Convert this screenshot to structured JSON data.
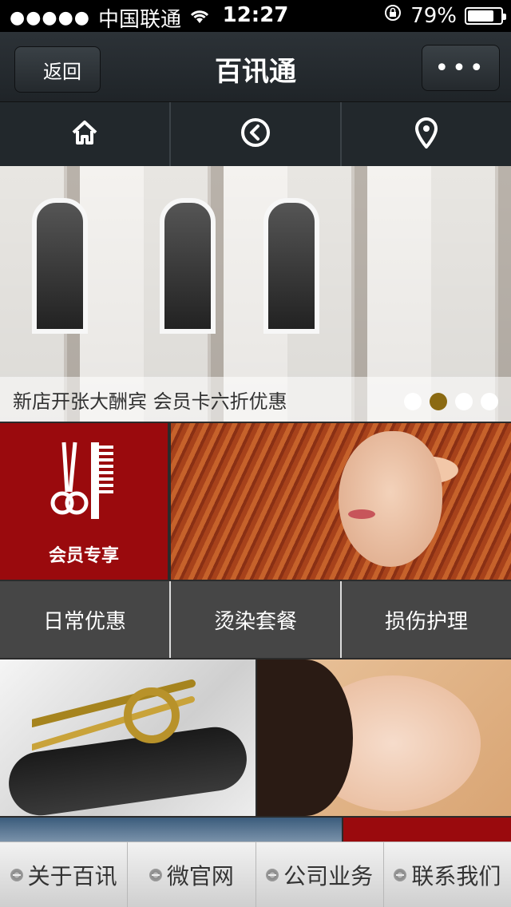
{
  "status_bar": {
    "signal": "●●●●●",
    "carrier": "中国联通",
    "time": "12:27",
    "battery_percent": "79%",
    "battery_level": 0.79
  },
  "nav": {
    "back_label": "返回",
    "title": "百讯通",
    "more_label": "•••"
  },
  "icon_row": [
    {
      "icon": "home-icon"
    },
    {
      "icon": "back-circle-icon"
    },
    {
      "icon": "location-pin-icon"
    }
  ],
  "banner": {
    "caption": "新店开张大酬宾 会员卡六折优惠",
    "dot_count": 4,
    "active_dot": 1
  },
  "tiles": {
    "member_label": "会员专享"
  },
  "menu_row": [
    "日常优惠",
    "烫染套餐",
    "损伤护理"
  ],
  "bottom_bar": [
    "关于百讯",
    "微官网",
    "公司业务",
    "联系我们"
  ],
  "colors": {
    "brand_red": "#9a0a0d",
    "dark_nav": "#22282c",
    "menu_gray": "#464646",
    "active_dot": "#8b6a12"
  }
}
